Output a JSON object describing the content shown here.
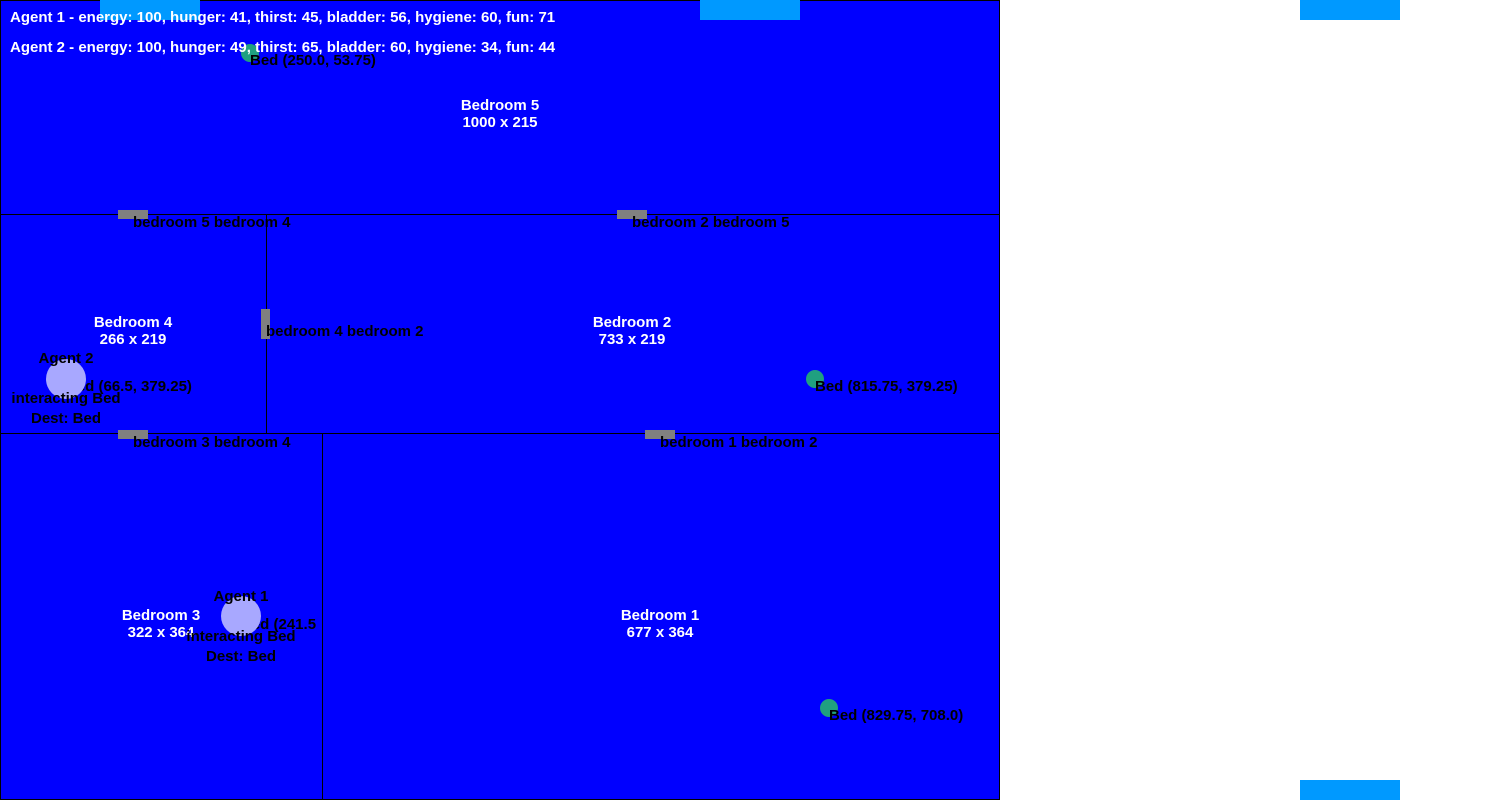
{
  "status": {
    "agent1": "Agent 1 - energy: 100, hunger: 41, thirst: 45, bladder: 56, hygiene: 60, fun: 71",
    "agent2": "Agent 2 - energy: 100, hunger: 49, thirst: 65, bladder: 60, hygiene: 34, fun: 44"
  },
  "rooms": {
    "bedroom5": {
      "name": "Bedroom 5",
      "size": "1000 x 215"
    },
    "bedroom4": {
      "name": "Bedroom 4",
      "size": "266 x 219"
    },
    "bedroom2": {
      "name": "Bedroom 2",
      "size": "733 x 219"
    },
    "bedroom3": {
      "name": "Bedroom 3",
      "size": "322 x 364"
    },
    "bedroom1": {
      "name": "Bedroom 1",
      "size": "677 x 364"
    }
  },
  "doors": {
    "d54": "bedroom 5 bedroom 4",
    "d25": "bedroom 2 bedroom 5",
    "d42": "bedroom 4 bedroom 2",
    "d34": "bedroom 3 bedroom 4",
    "d12": "bedroom 1 bedroom 2"
  },
  "objects": {
    "bed5": "Bed (250.0, 53.75)",
    "bed4": "Bed (66.5, 379.25)",
    "bed2": "Bed (815.75, 379.25)",
    "bed3": "Bed (241.5",
    "bed1": "Bed (829.75, 708.0)"
  },
  "agents": {
    "agent1": {
      "name": "Agent 1",
      "action": "interacting Bed",
      "dest": "Dest: Bed"
    },
    "agent2": {
      "name": "Agent 2",
      "action": "interacting Bed",
      "dest": "Dest: Bed"
    }
  },
  "colors": {
    "room": "#0000ff",
    "door": "#808080",
    "bed": "#20a080",
    "agent": "#a8a8ff",
    "marker": "#0099ff"
  }
}
